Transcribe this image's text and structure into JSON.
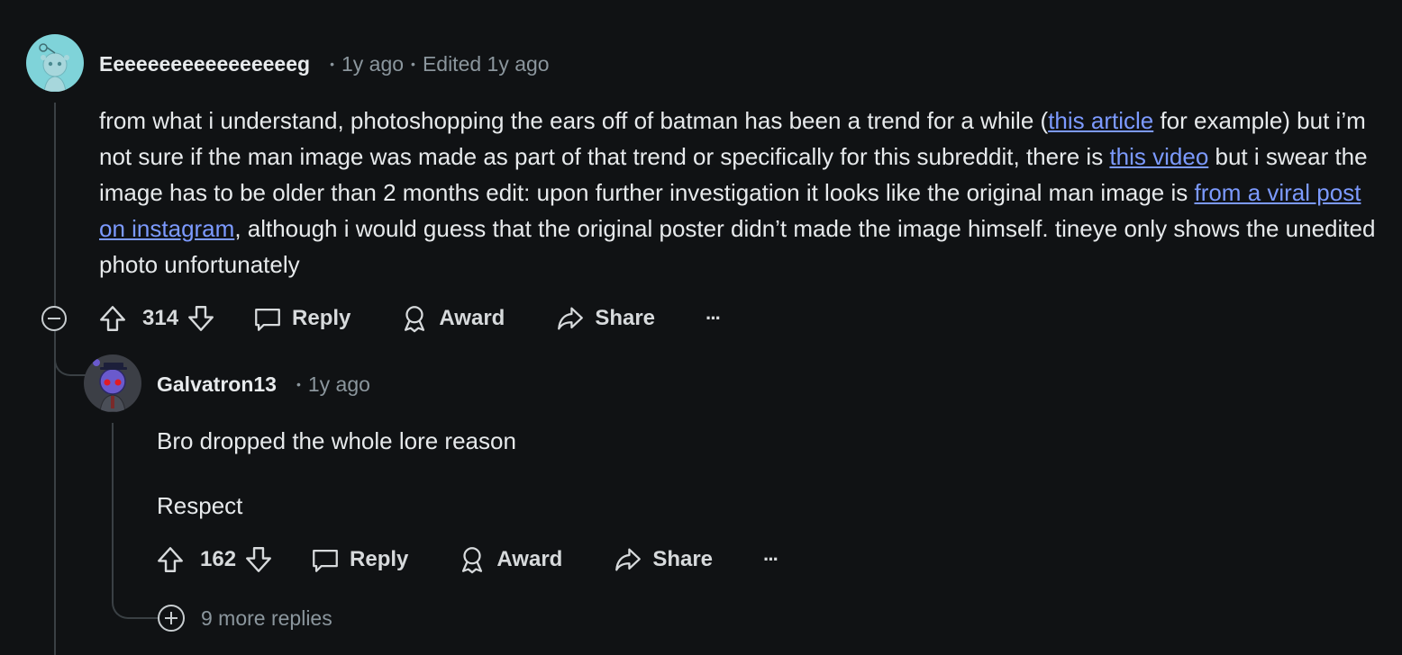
{
  "comment1": {
    "username": "Eeeeeeeeeeeeeeeeeg",
    "time": "1y ago",
    "edited": "Edited 1y ago",
    "text1": "from what i understand, photoshopping the ears off of batman has been a trend for a while (",
    "link1": "this article",
    "text2": " for example) but i’m not sure if the man image was made as part of that trend or specifically for this subreddit, there is ",
    "link2": "this video",
    "text3": " but i swear the image has to be older than 2 months edit: upon further investigation it looks like the original man image is ",
    "link3": "from a viral post on instagram",
    "text4": ", although i would guess that the original poster didn’t made the image himself. tineye only shows the unedited photo unfortunately",
    "votes": "314",
    "reply_label": "Reply",
    "award_label": "Award",
    "share_label": "Share",
    "more_label": "···"
  },
  "comment2": {
    "username": "Galvatron13",
    "time": "1y ago",
    "line1": "Bro dropped the whole lore reason",
    "line2": "Respect",
    "votes": "162",
    "reply_label": "Reply",
    "award_label": "Award",
    "share_label": "Share",
    "more_label": "···"
  },
  "more_replies": "9 more replies",
  "colors": {
    "background": "#101214",
    "link": "#7c9aff",
    "meta": "#8b969d",
    "avatar1": "#7fd3d9",
    "avatar2": "#3c3f46"
  }
}
